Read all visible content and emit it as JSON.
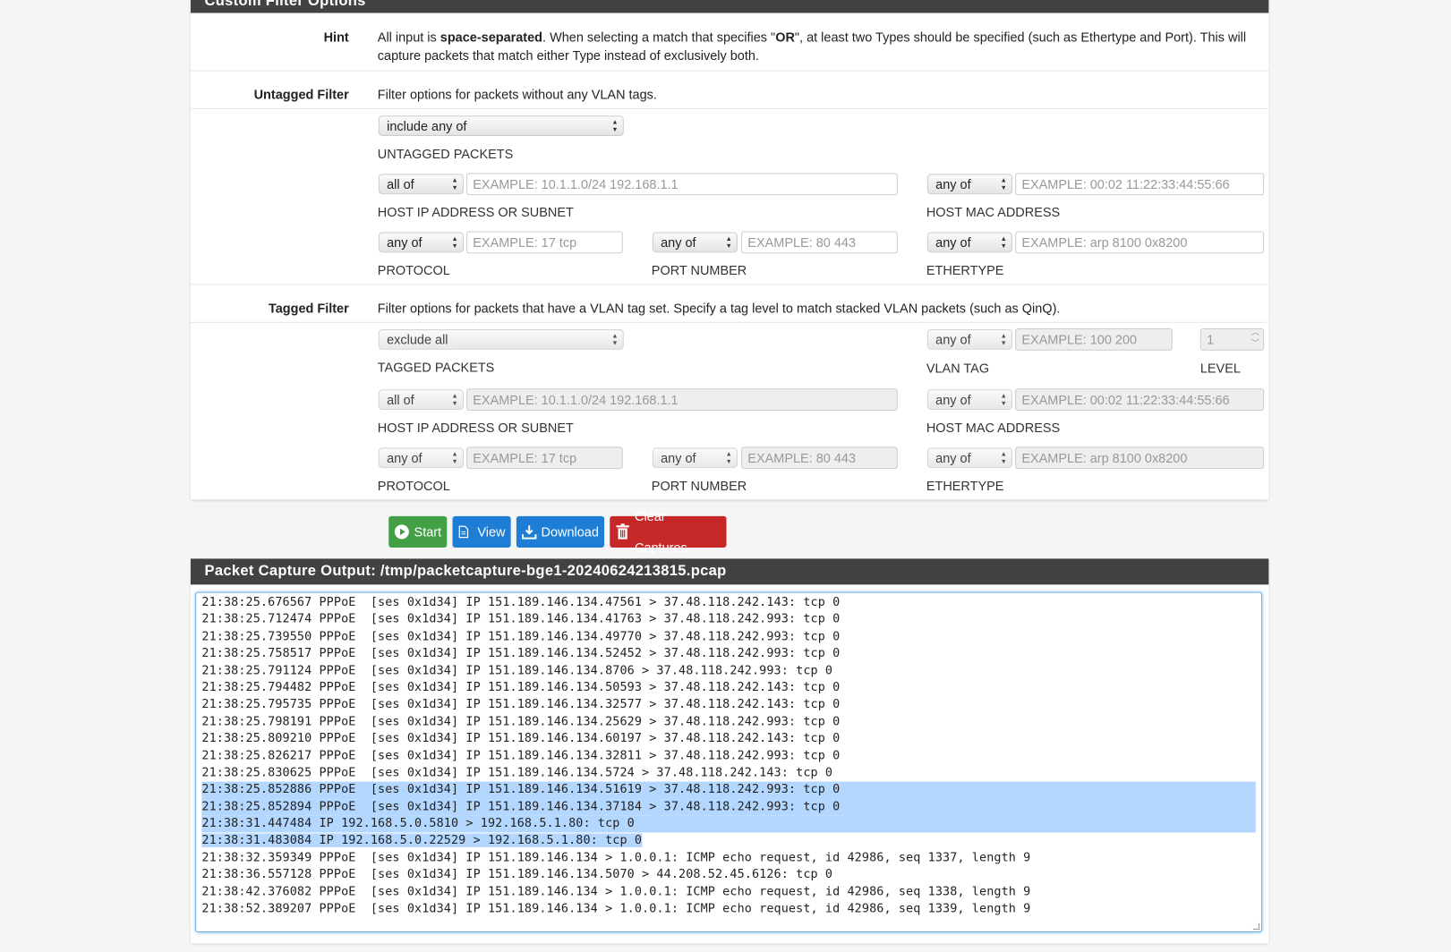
{
  "filter_panel": {
    "title": "Custom Filter Options",
    "hint": {
      "label": "Hint",
      "pre": "All input is ",
      "bold1": "space-separated",
      "mid": ". When selecting a match that specifies \"",
      "bold2": "OR",
      "post": "\", at least two Types should be specified (such as Ethertype and Port). This will capture packets that match either Type instead of exclusively both."
    },
    "untagged": {
      "label": "Untagged Filter",
      "description": "Filter options for packets without any VLAN tags.",
      "mode": "include any of",
      "mode_caption": "UNTAGGED PACKETS",
      "host_ip": {
        "match": "all of",
        "placeholder": "EXAMPLE: 10.1.1.0/24 192.168.1.1",
        "caption": "HOST IP ADDRESS OR SUBNET"
      },
      "host_mac": {
        "match": "any of",
        "placeholder": "EXAMPLE: 00:02 11:22:33:44:55:66",
        "caption": "HOST MAC ADDRESS"
      },
      "protocol": {
        "match": "any of",
        "placeholder": "EXAMPLE: 17 tcp",
        "caption": "PROTOCOL"
      },
      "port": {
        "match": "any of",
        "placeholder": "EXAMPLE: 80 443",
        "caption": "PORT NUMBER"
      },
      "ethertype": {
        "match": "any of",
        "placeholder": "EXAMPLE: arp 8100 0x8200",
        "caption": "ETHERTYPE"
      }
    },
    "tagged": {
      "label": "Tagged Filter",
      "description": "Filter options for packets that have a VLAN tag set. Specify a tag level to match stacked VLAN packets (such as QinQ).",
      "mode": "exclude all",
      "mode_caption": "TAGGED PACKETS",
      "vlan_tag": {
        "match": "any of",
        "placeholder": "EXAMPLE: 100 200",
        "caption": "VLAN TAG"
      },
      "level": {
        "value": "1",
        "caption": "LEVEL"
      },
      "host_ip": {
        "match": "all of",
        "placeholder": "EXAMPLE: 10.1.1.0/24 192.168.1.1",
        "caption": "HOST IP ADDRESS OR SUBNET"
      },
      "host_mac": {
        "match": "any of",
        "placeholder": "EXAMPLE: 00:02 11:22:33:44:55:66",
        "caption": "HOST MAC ADDRESS"
      },
      "protocol": {
        "match": "any of",
        "placeholder": "EXAMPLE: 17 tcp",
        "caption": "PROTOCOL"
      },
      "port": {
        "match": "any of",
        "placeholder": "EXAMPLE: 80 443",
        "caption": "PORT NUMBER"
      },
      "ethertype": {
        "match": "any of",
        "placeholder": "EXAMPLE: arp 8100 0x8200",
        "caption": "ETHERTYPE"
      }
    }
  },
  "buttons": {
    "start": "Start",
    "view": "View",
    "download": "Download",
    "clear": "Clear Captures"
  },
  "colors": {
    "start": "#43a047",
    "view": "#1e7ed6",
    "download": "#1e7ed6",
    "clear": "#c62828",
    "header": "#424242",
    "selection": "#b3d7ff"
  },
  "output": {
    "title": "Packet Capture Output: /tmp/packetcapture-bge1-20240624213815.pcap",
    "selected_lines": [
      11,
      12,
      13,
      14
    ],
    "lines": [
      "21:38:25.676567 PPPoE  [ses 0x1d34] IP 151.189.146.134.47561 > 37.48.118.242.143: tcp 0",
      "21:38:25.712474 PPPoE  [ses 0x1d34] IP 151.189.146.134.41763 > 37.48.118.242.993: tcp 0",
      "21:38:25.739550 PPPoE  [ses 0x1d34] IP 151.189.146.134.49770 > 37.48.118.242.993: tcp 0",
      "21:38:25.758517 PPPoE  [ses 0x1d34] IP 151.189.146.134.52452 > 37.48.118.242.993: tcp 0",
      "21:38:25.791124 PPPoE  [ses 0x1d34] IP 151.189.146.134.8706 > 37.48.118.242.993: tcp 0",
      "21:38:25.794482 PPPoE  [ses 0x1d34] IP 151.189.146.134.50593 > 37.48.118.242.143: tcp 0",
      "21:38:25.795735 PPPoE  [ses 0x1d34] IP 151.189.146.134.32577 > 37.48.118.242.143: tcp 0",
      "21:38:25.798191 PPPoE  [ses 0x1d34] IP 151.189.146.134.25629 > 37.48.118.242.993: tcp 0",
      "21:38:25.809210 PPPoE  [ses 0x1d34] IP 151.189.146.134.60197 > 37.48.118.242.143: tcp 0",
      "21:38:25.826217 PPPoE  [ses 0x1d34] IP 151.189.146.134.32811 > 37.48.118.242.993: tcp 0",
      "21:38:25.830625 PPPoE  [ses 0x1d34] IP 151.189.146.134.5724 > 37.48.118.242.143: tcp 0",
      "21:38:25.852886 PPPoE  [ses 0x1d34] IP 151.189.146.134.51619 > 37.48.118.242.993: tcp 0",
      "21:38:25.852894 PPPoE  [ses 0x1d34] IP 151.189.146.134.37184 > 37.48.118.242.993: tcp 0",
      "21:38:31.447484 IP 192.168.5.0.5810 > 192.168.5.1.80: tcp 0",
      "21:38:31.483084 IP 192.168.5.0.22529 > 192.168.5.1.80: tcp 0",
      "21:38:32.359349 PPPoE  [ses 0x1d34] IP 151.189.146.134 > 1.0.0.1: ICMP echo request, id 42986, seq 1337, length 9",
      "21:38:36.557128 PPPoE  [ses 0x1d34] IP 151.189.146.134.5070 > 44.208.52.45.6126: tcp 0",
      "21:38:42.376082 PPPoE  [ses 0x1d34] IP 151.189.146.134 > 1.0.0.1: ICMP echo request, id 42986, seq 1338, length 9",
      "21:38:52.389207 PPPoE  [ses 0x1d34] IP 151.189.146.134 > 1.0.0.1: ICMP echo request, id 42986, seq 1339, length 9"
    ]
  }
}
